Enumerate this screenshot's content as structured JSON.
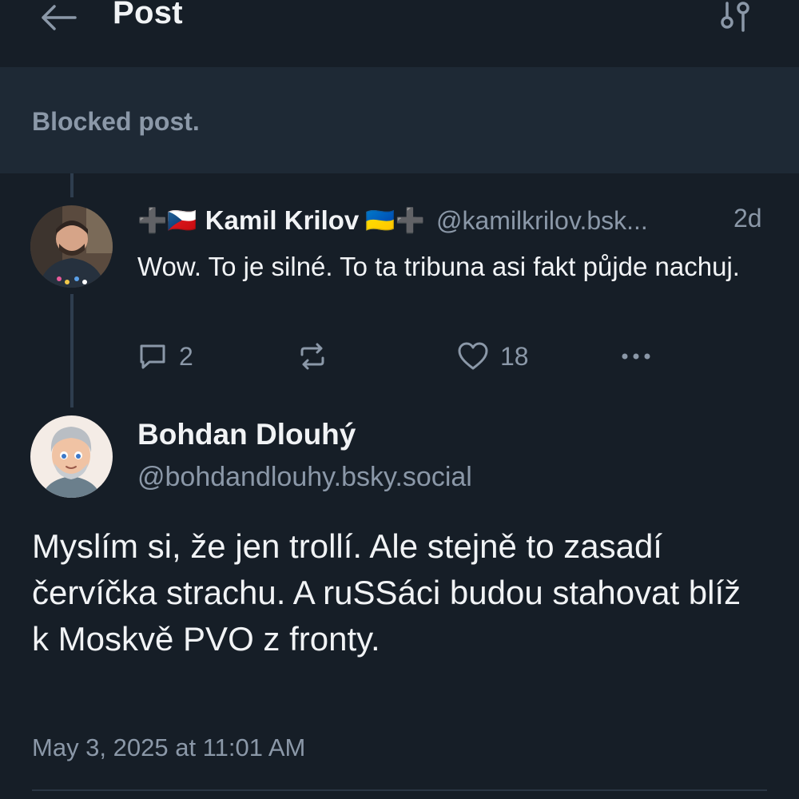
{
  "header": {
    "title": "Post",
    "back_icon": "arrow-left-icon",
    "filter_icon": "sliders-icon"
  },
  "blocked": {
    "text": "Blocked post."
  },
  "reply": {
    "name_prefix_emoji": "➕🇨🇿",
    "name": "Kamil Krilov",
    "name_suffix_emoji": "🇺🇦➕",
    "handle": "@kamilkrilov.bsk...",
    "time": "2d",
    "text": "Wow. To je silné. To ta tribuna asi fakt půjde nachuj.",
    "comments_count": "2",
    "likes_count": "18"
  },
  "main_post": {
    "name": "Bohdan Dlouhý",
    "handle": "@bohdandlouhy.bsky.social",
    "text": "Myslím si, že jen trollí. Ale stejně to zasadí červíčka strachu. A ruSSáci budou stahovat blíž k Moskvě PVO z fronty.",
    "timestamp": "May 3, 2025 at 11:01 AM"
  },
  "colors": {
    "background": "#161e27",
    "blocked_background": "#1e2935",
    "primary_text": "#f1f3f5",
    "secondary_text": "#8b98a8",
    "thread_line": "#2e3d4e"
  }
}
